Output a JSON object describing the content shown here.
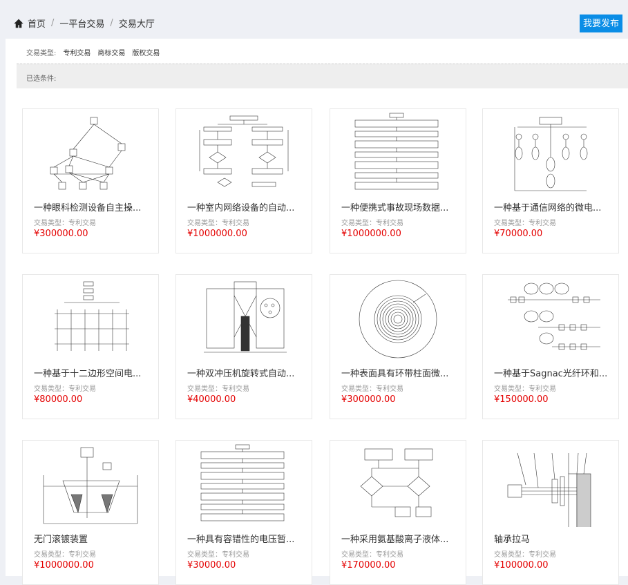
{
  "breadcrumb": {
    "home": "首页",
    "level1": "一平台交易",
    "level2": "交易大厅"
  },
  "publish_button": "我要发布",
  "filter": {
    "label": "交易类型:",
    "options": [
      "专利交易",
      "商标交易",
      "版权交易"
    ]
  },
  "selected_conditions": "已选条件:",
  "cards": [
    {
      "title": "一种眼科检测设备自主操...",
      "type": "交易类型：专利交易",
      "price": "¥300000.00"
    },
    {
      "title": "一种室内网络设备的自动...",
      "type": "交易类型：专利交易",
      "price": "¥1000000.00"
    },
    {
      "title": "一种便携式事故现场数据...",
      "type": "交易类型：专利交易",
      "price": "¥1000000.00"
    },
    {
      "title": "一种基于通信网络的微电...",
      "type": "交易类型：专利交易",
      "price": "¥70000.00"
    },
    {
      "title": "一种基于十二边形空间电...",
      "type": "交易类型：专利交易",
      "price": "¥80000.00"
    },
    {
      "title": "一种双冲压机旋转式自动...",
      "type": "交易类型：专利交易",
      "price": "¥40000.00"
    },
    {
      "title": "一种表面具有环带柱面微...",
      "type": "交易类型：专利交易",
      "price": "¥300000.00"
    },
    {
      "title": "一种基于Sagnac光纤环和...",
      "type": "交易类型：专利交易",
      "price": "¥150000.00"
    },
    {
      "title": "无门滚镀装置",
      "type": "交易类型：专利交易",
      "price": "¥1000000.00"
    },
    {
      "title": "一种具有容错性的电压暂...",
      "type": "交易类型：专利交易",
      "price": "¥30000.00"
    },
    {
      "title": "一种采用氨基酸离子液体...",
      "type": "交易类型：专利交易",
      "price": "¥170000.00"
    },
    {
      "title": "轴承拉马",
      "type": "交易类型：专利交易",
      "price": "¥100000.00"
    }
  ]
}
